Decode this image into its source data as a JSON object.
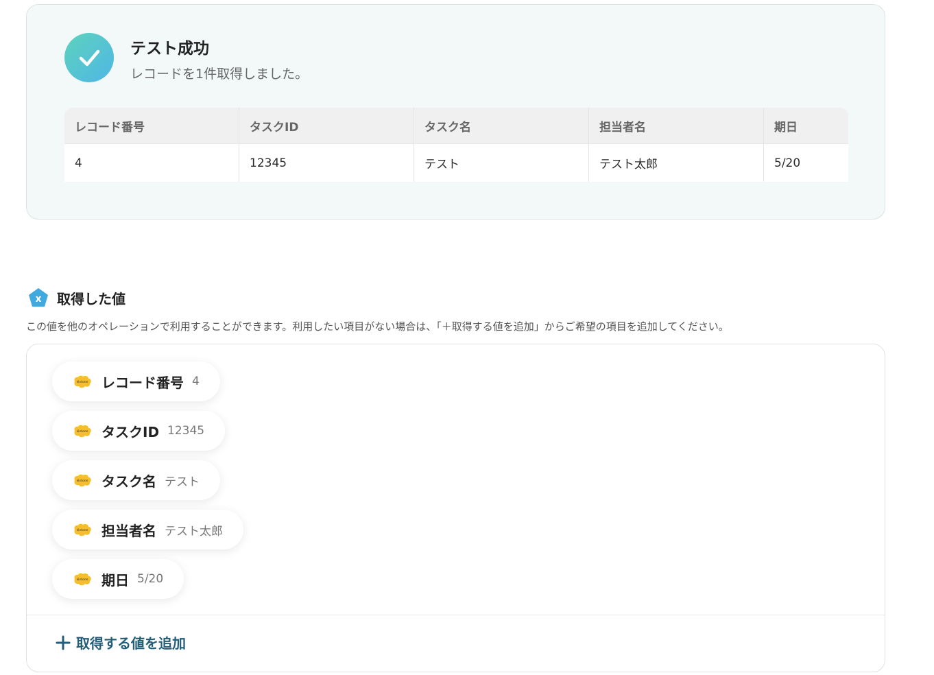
{
  "result": {
    "title": "テスト成功",
    "message": "レコードを1件取得しました。",
    "table": {
      "columns": [
        "レコード番号",
        "タスクID",
        "タスク名",
        "担当者名",
        "期日"
      ],
      "rows": [
        [
          "4",
          "12345",
          "テスト",
          "テスト太郎",
          "5/20"
        ]
      ]
    }
  },
  "values_section": {
    "title": "取得した値",
    "description": "この値を他のオペレーションで利用することができます。利用したい項目がない場合は、「＋取得する値を追加」からご希望の項目を追加してください。",
    "items": [
      {
        "name": "レコード番号",
        "value": "4",
        "logo_text": "kintone"
      },
      {
        "name": "タスクID",
        "value": "12345",
        "logo_text": "kintone"
      },
      {
        "name": "タスク名",
        "value": "テスト",
        "logo_text": "kintone"
      },
      {
        "name": "担当者名",
        "value": "テスト太郎",
        "logo_text": "kintone"
      },
      {
        "name": "期日",
        "value": "5/20",
        "logo_text": "kintone"
      }
    ],
    "add_label": "取得する値を追加"
  },
  "colors": {
    "accent": "#245d78",
    "success_gradient_start": "#5ed3bc",
    "success_gradient_end": "#4fb6e6",
    "kintone_yellow": "#f6be2c",
    "variable_icon": "#3fa9e0"
  }
}
